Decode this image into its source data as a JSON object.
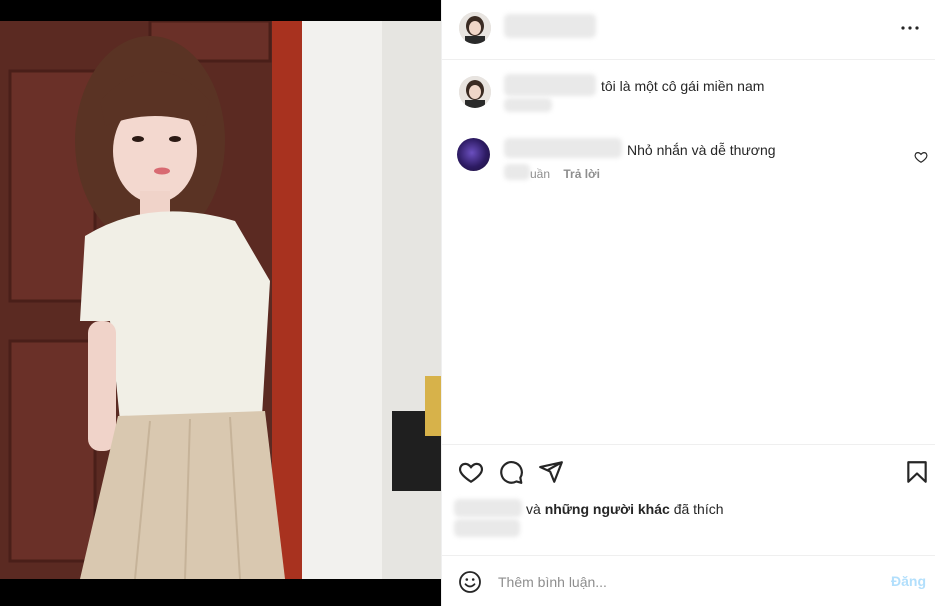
{
  "post": {
    "caption": "tôi là một cô gái miền nam"
  },
  "comment": {
    "text": "Nhỏ nhắn và dễ thương",
    "time_fragment": "uần",
    "reply_label": "Trả lời"
  },
  "likes": {
    "suffix_prefix": "và ",
    "others": "những người khác",
    "suffix": " đã thích"
  },
  "composer": {
    "placeholder": "Thêm bình luận...",
    "post_label": "Đăng"
  },
  "icons": {
    "more": "more-horizontal-icon",
    "like": "heart-icon",
    "comment": "comment-bubble-icon",
    "share": "paper-plane-icon",
    "save": "bookmark-icon",
    "emoji": "smiley-icon",
    "comment_like": "heart-small-icon"
  }
}
